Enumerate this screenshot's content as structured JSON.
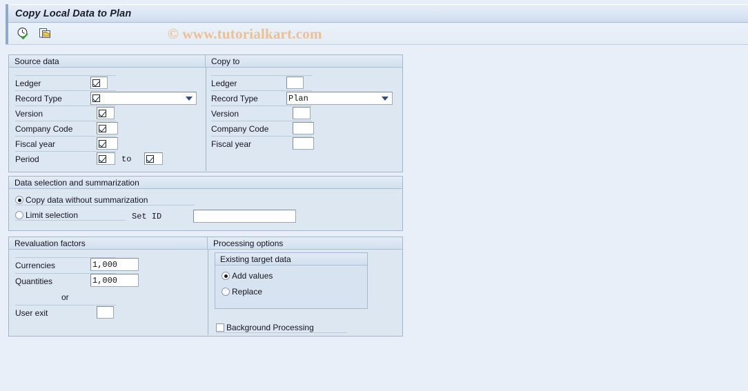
{
  "window": {
    "title": "Copy Local Data to Plan"
  },
  "toolbar": {
    "execute_icon": "clock-check-icon",
    "execute_label": "Execute",
    "copy_icon": "copy-multiple-icon",
    "copy_label": "Multiple Selection"
  },
  "watermark": {
    "text": "© www.tutorialkart.com",
    "color": "#edbf92"
  },
  "source_data": {
    "header": "Source data",
    "fields": [
      {
        "label": "Ledger",
        "value": "",
        "marker": "checked-box-glyph"
      },
      {
        "label": "Record Type",
        "value": "",
        "marker": "checked-box-glyph"
      },
      {
        "label": "Version",
        "value": "",
        "marker": "checked-box-glyph"
      },
      {
        "label": "Company Code",
        "value": "",
        "marker": "checked-box-glyph"
      },
      {
        "label": "Fiscal year",
        "value": "",
        "marker": "checked-box-glyph"
      },
      {
        "label": "Period",
        "value": "",
        "marker": "checked-box-glyph"
      }
    ],
    "period_to_label": "to",
    "period_to_value": ""
  },
  "copy_to": {
    "header": "Copy to",
    "fields": [
      {
        "label": "Ledger",
        "value": ""
      },
      {
        "label": "Record Type",
        "value": "Plan"
      },
      {
        "label": "Version",
        "value": ""
      },
      {
        "label": "Company Code",
        "value": ""
      },
      {
        "label": "Fiscal year",
        "value": ""
      }
    ]
  },
  "data_selection": {
    "header": "Data selection and summarization",
    "options": [
      {
        "label": "Copy data without summarization",
        "selected": true
      },
      {
        "label": "Limit selection",
        "selected": false
      }
    ],
    "set_id_label": "Set ID",
    "set_id_value": ""
  },
  "revaluation": {
    "header": "Revaluation factors",
    "currencies_label": "Currencies",
    "currencies_value": "1,000",
    "quantities_label": "Quantities",
    "quantities_value": "1,000",
    "or_label": "or",
    "user_exit_label": "User exit",
    "user_exit_value": ""
  },
  "processing": {
    "header": "Processing options",
    "existing_target_header": "Existing target data",
    "options": [
      {
        "label": "Add values",
        "selected": true
      },
      {
        "label": "Replace",
        "selected": false
      }
    ],
    "background_label": "Background Processing",
    "background_checked": false
  }
}
